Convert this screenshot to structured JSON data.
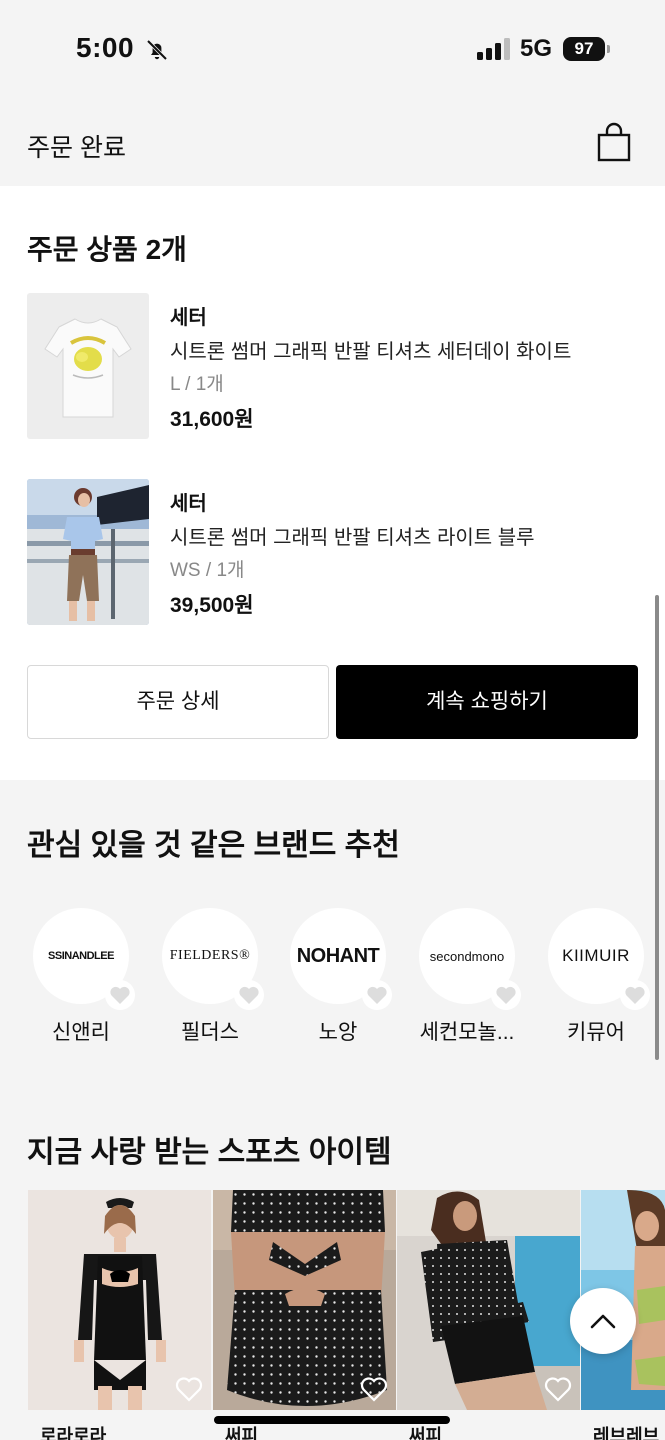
{
  "status_bar": {
    "time": "5:00",
    "network": "5G",
    "battery": "97"
  },
  "header": {
    "title": "주문 완료"
  },
  "order": {
    "title": "주문 상품 2개",
    "products": [
      {
        "brand": "세터",
        "name": "시트론 썸머 그래픽 반팔 티셔츠 세터데이 화이트",
        "option": "L / 1개",
        "price": "31,600원"
      },
      {
        "brand": "세터",
        "name": "시트론 썸머 그래픽 반팔 티셔츠 라이트 블루",
        "option": "WS / 1개",
        "price": "39,500원"
      }
    ],
    "detail_button": "주문 상세",
    "continue_button": "계속 쇼핑하기"
  },
  "brands": {
    "title": "관심 있을 것 같은 브랜드 추천",
    "items": [
      {
        "logo": "SSINANDLEE",
        "name": "신앤리"
      },
      {
        "logo": "FIELDERS®",
        "name": "필더스"
      },
      {
        "logo": "NOHANT",
        "name": "노앙"
      },
      {
        "logo": "secondmono",
        "name": "세컨모놀..."
      },
      {
        "logo": "KIIMUIR",
        "name": "키뮤어"
      }
    ]
  },
  "sports": {
    "title": "지금 사랑 받는 스포츠 아이템",
    "items": [
      {
        "brand": "로라로라"
      },
      {
        "brand": "써피"
      },
      {
        "brand": "써피"
      },
      {
        "brand": "레브레브"
      }
    ]
  },
  "icons": {
    "bell": "bell-slash-icon",
    "signal": "signal-icon",
    "bag": "shopping-bag-icon",
    "heart": "heart-outline-icon",
    "scroll_top": "chevron-up-icon"
  },
  "colors": {
    "background": "#f4f4f4",
    "card": "#ffffff",
    "primary_button": "#000000",
    "muted_text": "#888888"
  }
}
